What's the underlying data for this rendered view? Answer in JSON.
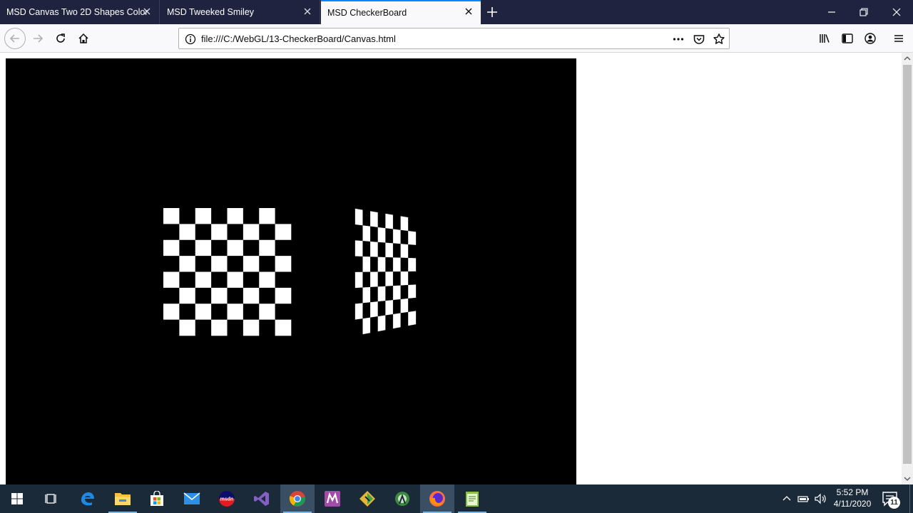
{
  "browser": {
    "tabs": [
      {
        "title": "MSD Canvas Two 2D Shapes Color",
        "active": false
      },
      {
        "title": "MSD Tweeked Smiley",
        "active": false
      },
      {
        "title": "MSD CheckerBoard",
        "active": true
      }
    ],
    "url": "file:///C:/WebGL/13-CheckerBoard/Canvas.html"
  },
  "canvas": {
    "background": "#000000",
    "board_colors": [
      "#ffffff",
      "#000000"
    ],
    "boards": [
      {
        "rows": 8,
        "cols": 8,
        "first_square": "white",
        "view": "front"
      },
      {
        "rows": 8,
        "cols": 8,
        "first_square": "white",
        "view": "rotated"
      }
    ]
  },
  "taskbar": {
    "apps": [
      {
        "icon": "task-view-icon",
        "running": false
      },
      {
        "icon": "edge-icon",
        "running": false
      },
      {
        "icon": "file-explorer-icon",
        "running": true
      },
      {
        "icon": "store-icon",
        "running": false
      },
      {
        "icon": "mail-icon",
        "running": false
      },
      {
        "icon": "msdn-icon",
        "running": false
      },
      {
        "icon": "visual-studio-icon",
        "running": false
      },
      {
        "icon": "chrome-icon",
        "running": true
      },
      {
        "icon": "m-app-icon",
        "running": false
      },
      {
        "icon": "git-icon",
        "running": false
      },
      {
        "icon": "android-studio-icon",
        "running": false
      },
      {
        "icon": "firefox-icon",
        "running": true
      },
      {
        "icon": "notepad-icon",
        "running": true
      }
    ],
    "time": "5:52 PM",
    "date": "4/11/2020",
    "notification_count": "11"
  },
  "colors": {
    "tabstrip": "#202340",
    "active_tab_accent": "#0a84ff",
    "taskbar": "#1b2a38"
  }
}
